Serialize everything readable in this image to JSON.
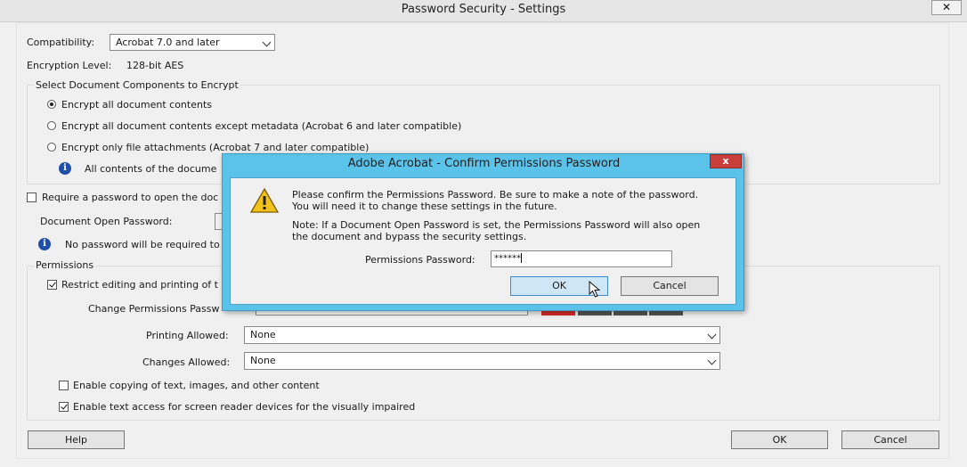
{
  "window": {
    "title": "Password Security - Settings",
    "close_glyph": "✕"
  },
  "compatibility": {
    "label": "Compatibility:",
    "value": "Acrobat 7.0 and later"
  },
  "encryption": {
    "label": "Encryption  Level:",
    "value": "128-bit AES"
  },
  "components": {
    "header": "Select Document Components to Encrypt",
    "options": [
      {
        "label": "Encrypt all document contents",
        "selected": true
      },
      {
        "label": "Encrypt all document contents except metadata (Acrobat 6 and later compatible)",
        "selected": false
      },
      {
        "label": "Encrypt only file attachments (Acrobat 7 and later compatible)",
        "selected": false
      }
    ],
    "info": "All contents of the docume"
  },
  "open_password": {
    "require_label": "Require a password to open the doc",
    "require_checked": false,
    "field_label": "Document Open Password:",
    "info": "No password will be required to"
  },
  "permissions": {
    "header": "Permissions",
    "restrict_label": "Restrict editing and printing of t",
    "restrict_checked": true,
    "change_label": "Change Permissions Passw",
    "printing_label": "Printing Allowed:",
    "printing_value": "None",
    "changes_label": "Changes Allowed:",
    "changes_value": "None",
    "copy_label": "Enable copying of text, images, and other content",
    "copy_checked": false,
    "screenreader_label": "Enable text access for screen reader devices for the visually impaired",
    "screenreader_checked": true
  },
  "footer": {
    "help": "Help",
    "ok": "OK",
    "cancel": "Cancel"
  },
  "dialog": {
    "title": "Adobe Acrobat - Confirm Permissions Password",
    "close_glyph": "x",
    "message_line1": "Please confirm the Permissions Password. Be sure to make a note of the password.",
    "message_line2": "You will need it to change these settings in the future.",
    "note_line1": "Note: If a Document Open Password is set, the Permissions Password will also open",
    "note_line2": "the document and bypass the security settings.",
    "password_label": "Permissions Password:",
    "password_value": "******",
    "ok": "OK",
    "cancel": "Cancel"
  },
  "colors": {
    "dialog_frame": "#5bc3ea",
    "ok_focus": "#cfe6f7",
    "strength_red": "#d42a2a",
    "strength_gray": "#555555"
  },
  "icons": [
    "close-icon",
    "info-icon",
    "warning-icon",
    "chevron-down-icon",
    "mouse-cursor-icon"
  ]
}
